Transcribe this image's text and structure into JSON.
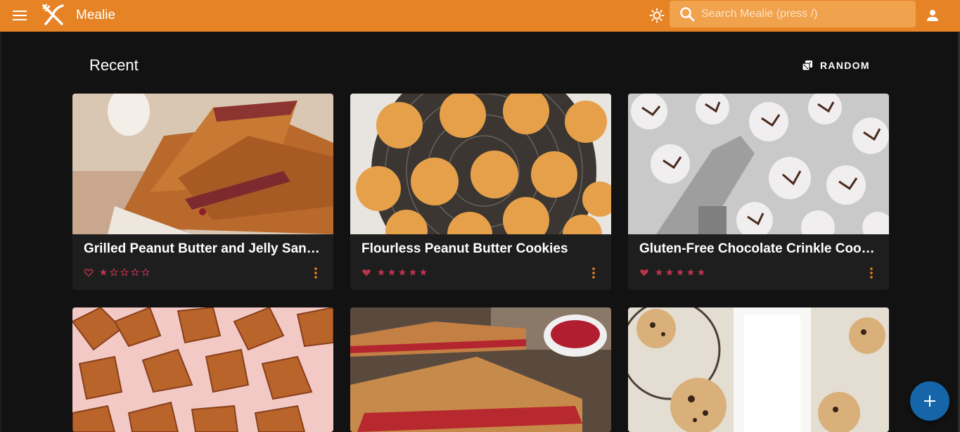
{
  "appbar": {
    "title": "Mealie",
    "search_placeholder": "Search Mealie (press /)",
    "icons": {
      "menu": "menu-icon",
      "logo": "fork-knife-icon",
      "theme": "brightness-icon",
      "search": "search-icon",
      "user": "account-icon"
    }
  },
  "colors": {
    "primary": "#e58325",
    "background": "#121212",
    "card": "#1e1e1e",
    "accent": "#b9344e",
    "fab": "#1565a8"
  },
  "section": {
    "title": "Recent",
    "random_label": "RANDOM"
  },
  "recipes": [
    {
      "title": "Grilled Peanut Butter and Jelly Sandwich",
      "favorite": false,
      "rating": 0
    },
    {
      "title": "Flourless Peanut Butter Cookies",
      "favorite": true,
      "rating": 5
    },
    {
      "title": "Gluten-Free Chocolate Crinkle Cookies",
      "favorite": true,
      "rating": 5
    },
    {
      "title": "",
      "favorite": false,
      "rating": 0
    },
    {
      "title": "",
      "favorite": false,
      "rating": 0
    },
    {
      "title": "",
      "favorite": false,
      "rating": 0
    }
  ],
  "fab": {
    "icon": "plus-icon"
  }
}
